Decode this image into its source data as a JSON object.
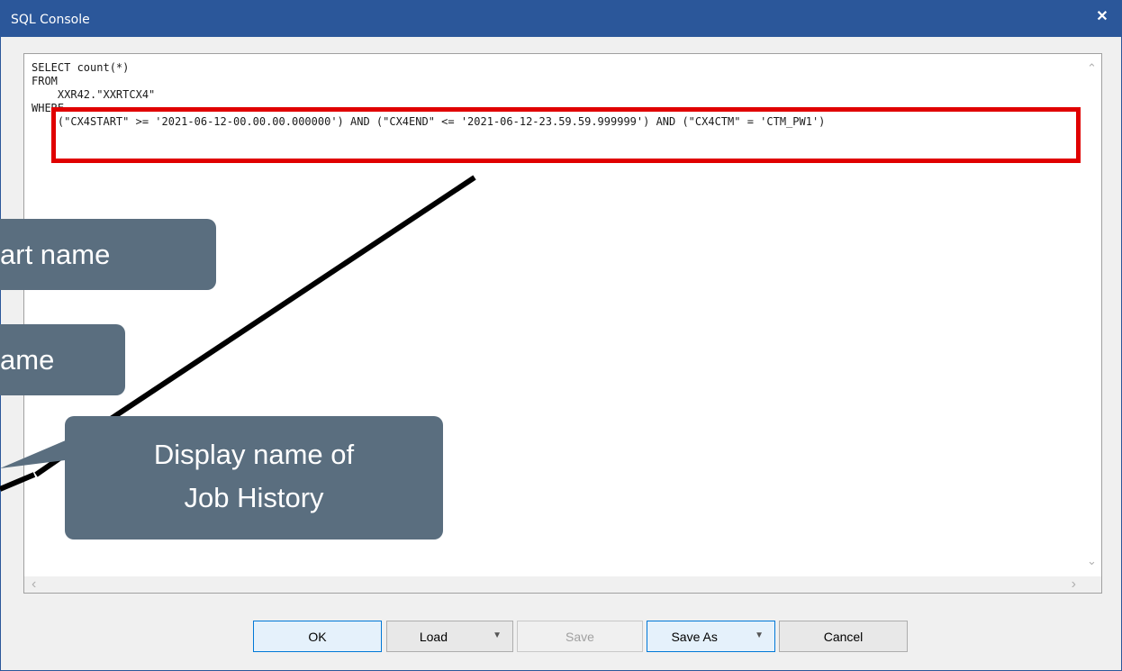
{
  "window": {
    "title": "SQL Console",
    "close_glyph": "✕"
  },
  "editor": {
    "lines": [
      "SELECT count(*)",
      "FROM",
      "    XXR42.\"XXRTCX4\"",
      "WHERE",
      "    (\"CX4START\" >= '2021-06-12-00.00.00.000000') AND (\"CX4END\" <= '2021-06-12-23.59.59.999999') AND (\"CX4CTM\" = 'CTM_PW1')"
    ],
    "scroll_up": "⌃",
    "scroll_down": "⌄",
    "scroll_left": "‹",
    "scroll_right": "›"
  },
  "buttons": {
    "ok": "OK",
    "load": "Load",
    "save": "Save",
    "save_as": "Save As",
    "cancel": "Cancel",
    "dropdown_glyph": "▼"
  },
  "callouts": {
    "c1": "art name",
    "c2": "ame",
    "c3_line1": "Display name of",
    "c3_line2": "Job History"
  },
  "colors": {
    "title_bar": "#2b579a",
    "callout": "#5a6e7f",
    "highlight": "#e00000"
  }
}
